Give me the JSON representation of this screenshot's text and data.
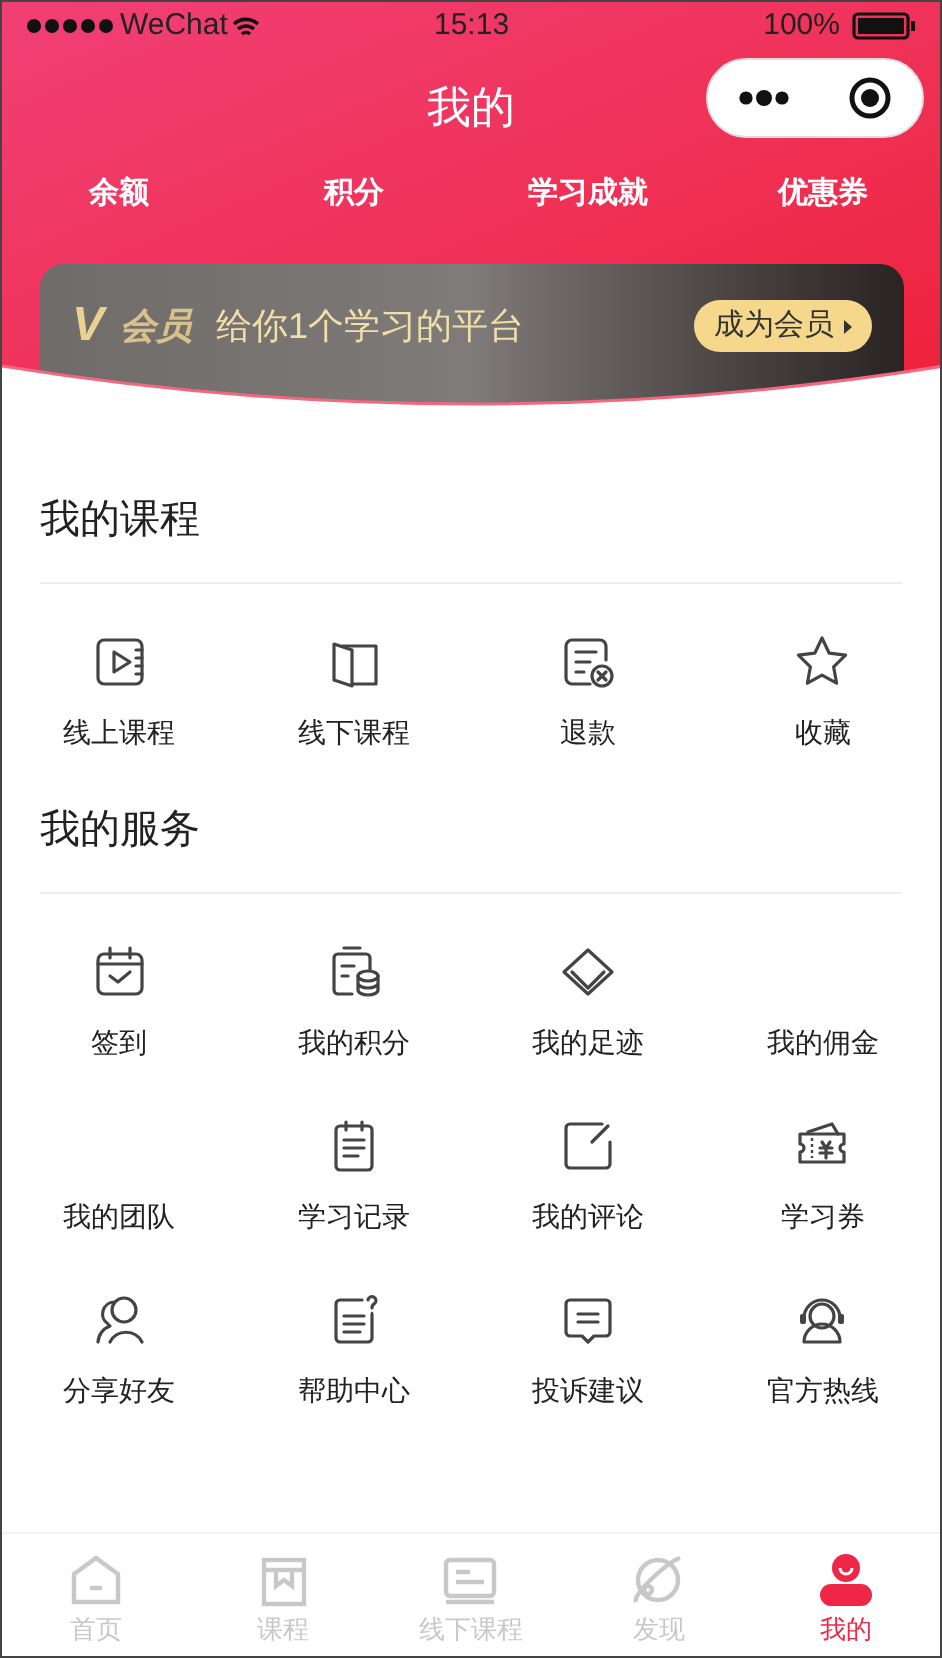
{
  "status_bar": {
    "carrier": "WeChat",
    "time": "15:13",
    "battery": "100%"
  },
  "header": {
    "title": "我的",
    "stats": [
      "余额",
      "积分",
      "学习成就",
      "优惠券"
    ]
  },
  "member_card": {
    "logo": "V",
    "label": "会员",
    "slogan": "给你1个学习的平台",
    "button": "成为会员"
  },
  "sections": [
    {
      "title": "我的课程",
      "items": [
        {
          "label": "线上课程",
          "icon": true
        },
        {
          "label": "线下课程",
          "icon": true
        },
        {
          "label": "退款",
          "icon": true
        },
        {
          "label": "收藏",
          "icon": true
        }
      ]
    },
    {
      "title": "我的服务",
      "items": [
        {
          "label": "签到",
          "icon": true
        },
        {
          "label": "我的积分",
          "icon": true
        },
        {
          "label": "我的足迹",
          "icon": true
        },
        {
          "label": "我的佣金",
          "icon": false
        },
        {
          "label": "我的团队",
          "icon": false
        },
        {
          "label": "学习记录",
          "icon": true
        },
        {
          "label": "我的评论",
          "icon": true
        },
        {
          "label": "学习券",
          "icon": true
        },
        {
          "label": "分享好友",
          "icon": true
        },
        {
          "label": "帮助中心",
          "icon": true
        },
        {
          "label": "投诉建议",
          "icon": true
        },
        {
          "label": "官方热线",
          "icon": true
        }
      ]
    }
  ],
  "tab_bar": [
    {
      "label": "首页",
      "selected": false
    },
    {
      "label": "课程",
      "selected": false
    },
    {
      "label": "线下课程",
      "selected": false
    },
    {
      "label": "发现",
      "selected": false
    },
    {
      "label": "我的",
      "selected": true
    }
  ]
}
